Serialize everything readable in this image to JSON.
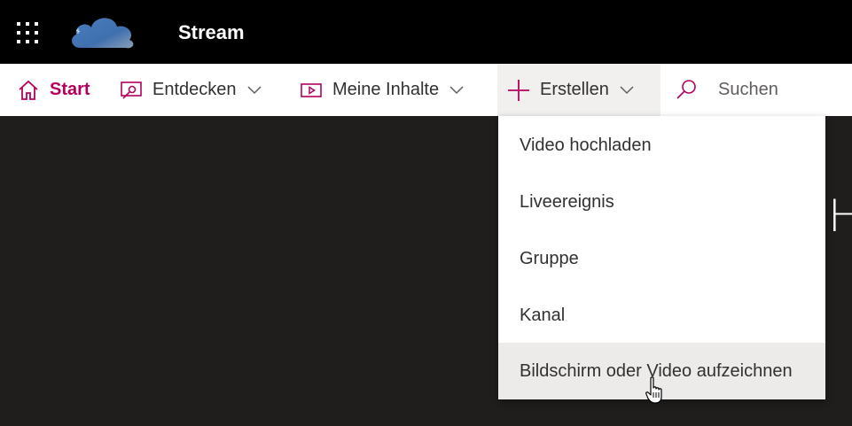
{
  "header": {
    "app_title": "Stream",
    "waffle_icon": "app-launcher-icon",
    "logo_icon": "cloud-logo"
  },
  "nav": {
    "start": "Start",
    "entdecken": "Entdecken",
    "meine_inhalte": "Meine Inhalte",
    "erstellen": "Erstellen",
    "search_placeholder": "Suchen"
  },
  "create_menu": {
    "items": [
      "Video hochladen",
      "Liveereignis",
      "Gruppe",
      "Kanal",
      "Bildschirm oder Video aufzeichnen"
    ],
    "hovered_item": "Bildschirm oder Video aufzeichnen"
  },
  "background": {
    "partial_heading": "H"
  },
  "colors": {
    "accent": "#b4005d",
    "topbar": "#000000",
    "content_bg": "#201d1d",
    "menu_hover": "#ecebea"
  }
}
